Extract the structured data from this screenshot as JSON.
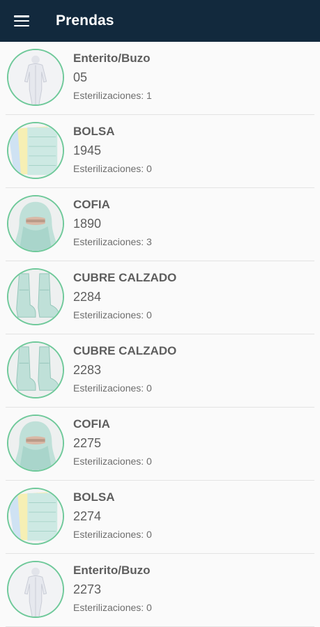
{
  "appbar": {
    "title": "Prendas",
    "background": "#12293d",
    "menu_icon": "hamburger-menu-icon"
  },
  "accent_color": "#6fc99a",
  "items": [
    {
      "name": "Enterito/Buzo",
      "code": "05",
      "sterilizations": "Esterilizaciones: 1",
      "icon": "coverall-icon"
    },
    {
      "name": "BOLSA",
      "code": "1945",
      "sterilizations": "Esterilizaciones: 0",
      "icon": "bag-icon"
    },
    {
      "name": "COFIA",
      "code": "1890",
      "sterilizations": "Esterilizaciones: 3",
      "icon": "hood-icon"
    },
    {
      "name": "CUBRE CALZADO",
      "code": "2284",
      "sterilizations": "Esterilizaciones: 0",
      "icon": "shoe-cover-icon"
    },
    {
      "name": "CUBRE CALZADO",
      "code": "2283",
      "sterilizations": "Esterilizaciones: 0",
      "icon": "shoe-cover-icon"
    },
    {
      "name": "COFIA",
      "code": "2275",
      "sterilizations": "Esterilizaciones: 0",
      "icon": "hood-icon"
    },
    {
      "name": "BOLSA",
      "code": "2274",
      "sterilizations": "Esterilizaciones: 0",
      "icon": "bag-icon"
    },
    {
      "name": "Enterito/Buzo",
      "code": "2273",
      "sterilizations": "Esterilizaciones: 0",
      "icon": "coverall-icon"
    }
  ]
}
